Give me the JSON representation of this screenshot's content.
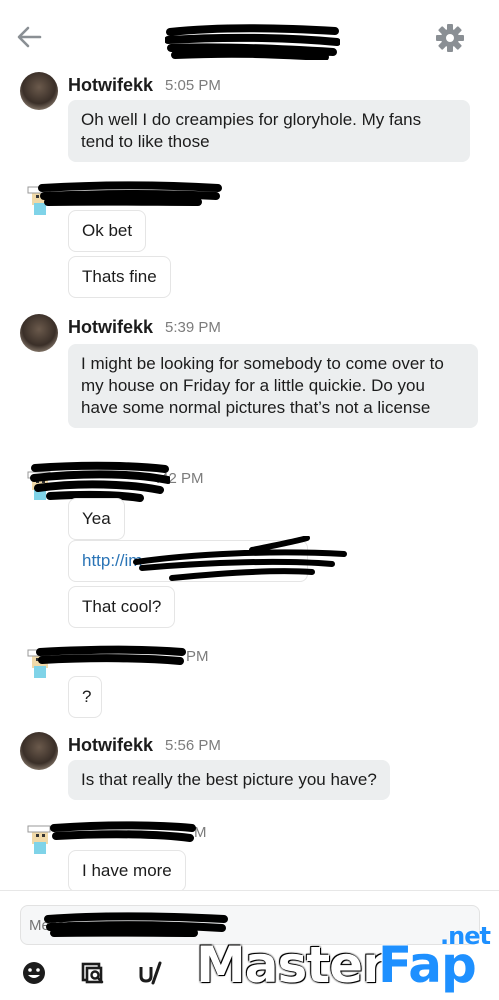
{
  "header": {
    "back_icon": "arrow-left-icon",
    "settings_icon": "gear-icon"
  },
  "messages": [
    {
      "user": "Hotwifekk",
      "time": "5:05 PM",
      "text": "Oh well I do creampies for gloryhole. My fans tend to like those"
    },
    {
      "text": "Ok bet"
    },
    {
      "text": "Thats fine"
    },
    {
      "user": "Hotwifekk",
      "time": "5:39 PM",
      "text": "I might be looking for somebody to come over to my house on Friday for a little quickie. Do you have some normal pictures that’s not a license"
    },
    {
      "time_partial": ":42 PM",
      "text": "Yea"
    },
    {
      "text": "http://im"
    },
    {
      "text": "That cool?"
    },
    {
      "time_partial": "PM",
      "text": "?"
    },
    {
      "user": "Hotwifekk",
      "time": "5:56 PM",
      "text": "Is that really the best picture you have?"
    },
    {
      "time_partial": "M",
      "text": "I have more"
    }
  ],
  "composer": {
    "placeholder": "Messag",
    "tools": [
      "emoji-icon",
      "gallery-search-icon",
      "username-icon"
    ]
  },
  "watermark": {
    "master": "Master",
    "fap": "Fap",
    "net": ".net"
  },
  "colors": {
    "bubble_received": "#eceeef",
    "link": "#2a74b6",
    "timestamp": "#7c7c7c",
    "watermark_accent": "#1e90ff"
  }
}
